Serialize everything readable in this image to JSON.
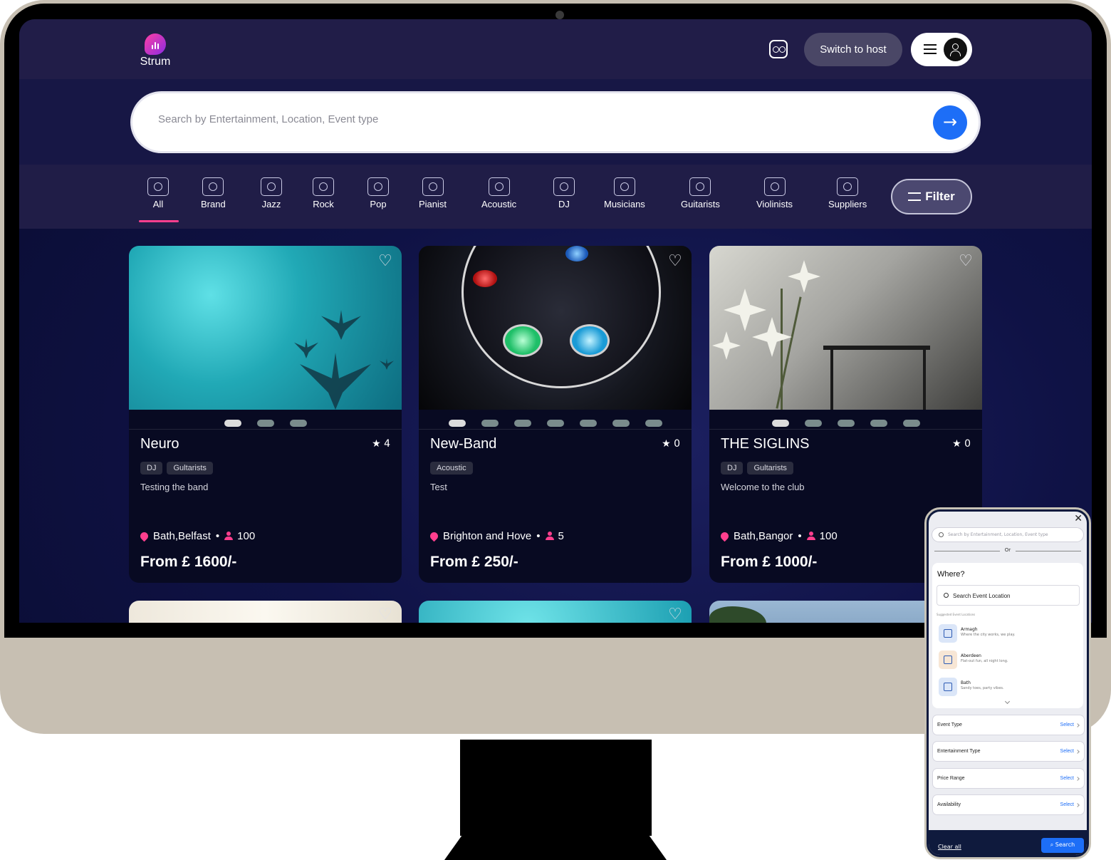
{
  "app": {
    "name": "Strum"
  },
  "header": {
    "switch_label": "Switch to host"
  },
  "search": {
    "placeholder": "Search by Entertainment, Location, Event type"
  },
  "categories": [
    {
      "label": "All"
    },
    {
      "label": "Brand"
    },
    {
      "label": "Jazz"
    },
    {
      "label": "Rock"
    },
    {
      "label": "Pop"
    },
    {
      "label": "Pianist"
    },
    {
      "label": "Acoustic"
    },
    {
      "label": "DJ"
    },
    {
      "label": "Musicians"
    },
    {
      "label": "Guitarists"
    },
    {
      "label": "Violinists"
    },
    {
      "label": "Suppliers"
    }
  ],
  "filter_label": "Filter",
  "cards": [
    {
      "title": "Neuro",
      "rating": "4",
      "tags": [
        "DJ",
        "Gultarists"
      ],
      "description": "Testing the band",
      "location": "Bath,Belfast",
      "capacity": "100",
      "price": "From £ 1600/-"
    },
    {
      "title": "New-Band",
      "rating": "0",
      "tags": [
        "Acoustic"
      ],
      "description": "Test",
      "location": "Brighton and Hove",
      "capacity": "5",
      "price": "From £ 250/-"
    },
    {
      "title": "THE SIGLINS",
      "rating": "0",
      "tags": [
        "DJ",
        "Gultarists"
      ],
      "description": "Welcome to the club",
      "location": "Bath,Bangor",
      "capacity": "100",
      "price": "From £ 1000/-"
    }
  ],
  "mobile": {
    "search_placeholder": "Search by Entertainment, Location, Event type",
    "or_label": "Or",
    "where_title": "Where?",
    "location_input": "Search Event Location",
    "suggested_label": "Suggested Event Locations",
    "suggestions": [
      {
        "name": "Armagh",
        "tagline": "Where the city works, we play."
      },
      {
        "name": "Aberdeen",
        "tagline": "Flat-out fun, all night long."
      },
      {
        "name": "Bath",
        "tagline": "Sandy toes, party vibes."
      }
    ],
    "rows": [
      {
        "label": "Event Type",
        "action": "Select"
      },
      {
        "label": "Entertainment Type",
        "action": "Select"
      },
      {
        "label": "Price Range",
        "action": "Select"
      },
      {
        "label": "Availability",
        "action": "Select"
      }
    ],
    "clear_label": "Clear all",
    "search_label": "Search"
  },
  "colors": {
    "accent": "#ff3f8e",
    "primary": "#1d6ef7",
    "topbar": "#211d48"
  }
}
